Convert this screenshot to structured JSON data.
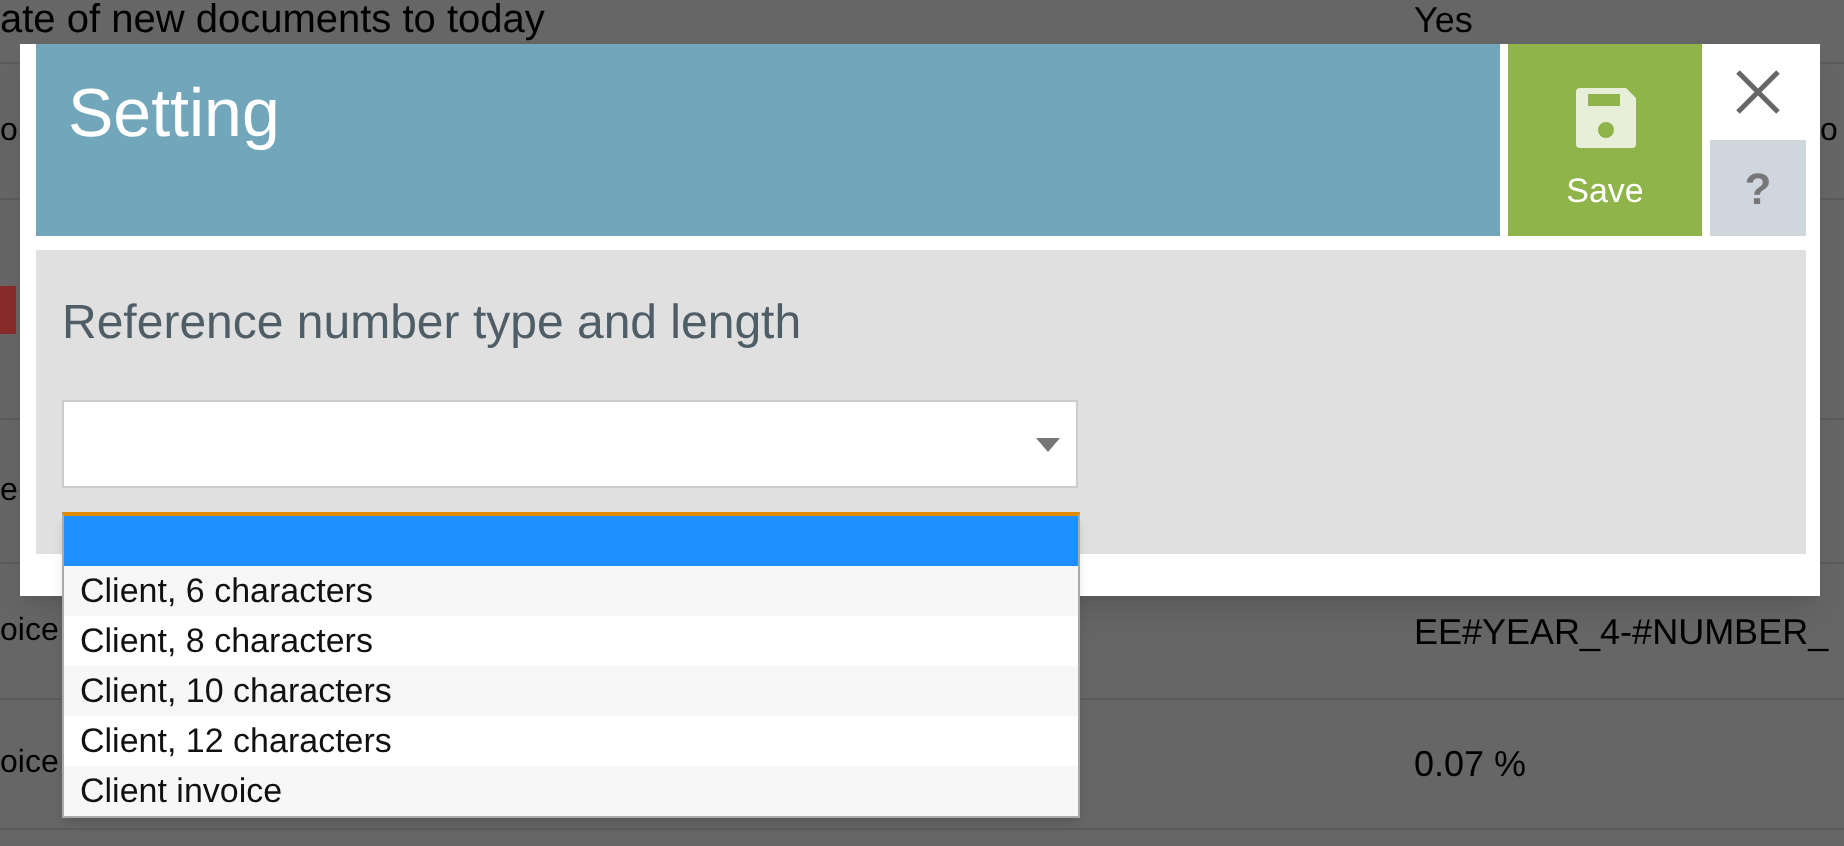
{
  "background_table": {
    "rows": [
      {
        "cells": [
          "ate of new documents to today",
          "Yes",
          ""
        ],
        "flagged": false
      },
      {
        "cells": [
          "o",
          "",
          "o"
        ],
        "flagged": false
      },
      {
        "cells": [
          "",
          "",
          ""
        ],
        "flagged": true
      },
      {
        "cells": [
          "e",
          "",
          ""
        ],
        "flagged": false
      },
      {
        "cells": [
          "oice",
          "EE#YEAR_4-#NUMBER_",
          ""
        ],
        "flagged": false
      },
      {
        "cells": [
          "oice",
          "0.07 %",
          ""
        ],
        "flagged": false
      }
    ]
  },
  "dialog": {
    "title": "Setting",
    "save_button": "Save",
    "help_button": "?",
    "field": {
      "label": "Reference number type and length",
      "expanded": true,
      "options": [
        {
          "selected": true
        },
        {
          "label": "Client, 6 characters",
          "selected": false
        },
        {
          "label": "Client, 8 characters",
          "selected": false
        },
        {
          "label": "Client, 10 characters",
          "selected": false
        },
        {
          "label": "Client, 12 characters",
          "selected": false
        },
        {
          "label": "Client invoice",
          "selected": false
        }
      ]
    }
  }
}
